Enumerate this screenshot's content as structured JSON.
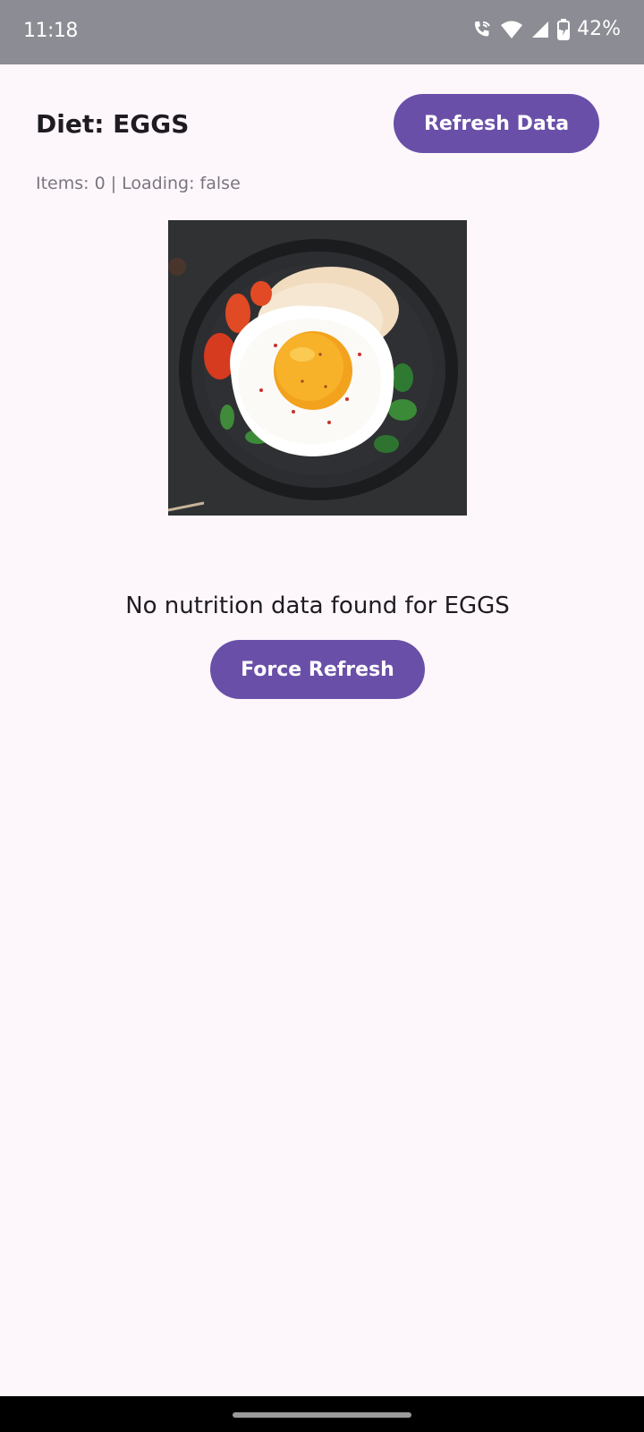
{
  "status_bar": {
    "time": "11:18",
    "battery_percent": "42%",
    "icons": [
      "call-wifi-icon",
      "wifi-icon",
      "signal-icon",
      "battery-charging-icon"
    ]
  },
  "screen": {
    "title": "Diet: EGGS",
    "refresh_button_label": "Refresh Data",
    "meta_text": "Items: 0 | Loading: false",
    "empty_message": "No nutrition data found for EGGS",
    "force_refresh_label": "Force Refresh"
  },
  "colors": {
    "accent": "#6a4fa8",
    "background": "#fdf7fb",
    "status_bar": "#8c8c94"
  }
}
